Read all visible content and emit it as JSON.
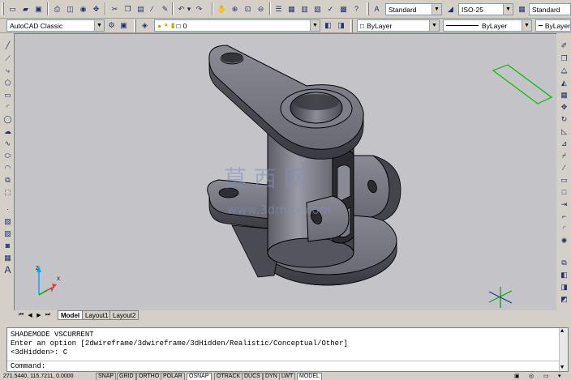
{
  "toolbar_top": {
    "text_style": "Standard",
    "dim_style": "ISO-25",
    "table_style": "Standard"
  },
  "toolbar_layers": {
    "workspace": "AutoCAD Classic",
    "layer": "0",
    "color": "ByLayer",
    "linetype": "ByLayer",
    "lineweight": "ByLayer"
  },
  "layout_tabs": [
    "Model",
    "Layout1",
    "Layout2"
  ],
  "command_window": {
    "lines": [
      "SHADEMODE VSCURRENT",
      "Enter an option [2dwireframe/3dwireframe/3dHidden/Realistic/Conceptual/Other]",
      "<3dHidden>: C"
    ],
    "prompt": "Command:"
  },
  "status_bar": {
    "coordinates": "271.5440, 115.7211, 0.0000",
    "toggles": [
      "SNAP",
      "GRID",
      "ORTHO",
      "POLAR",
      "OSNAP",
      "OTRACK",
      "DUCS",
      "DYN",
      "LWT",
      "MODEL"
    ],
    "active_toggles": [
      "OSNAP",
      "MODEL"
    ]
  },
  "watermark": {
    "cn": "莫 西 网",
    "url": "www.3dmox.com"
  },
  "ucs": {
    "x": "X",
    "y": "Y",
    "z": "Z"
  },
  "colors": {
    "viewport_bg": "#c4c4c8",
    "model_dark": "#4a4a52",
    "model_light": "#9a9aa4",
    "accent_green": "#00c000"
  }
}
